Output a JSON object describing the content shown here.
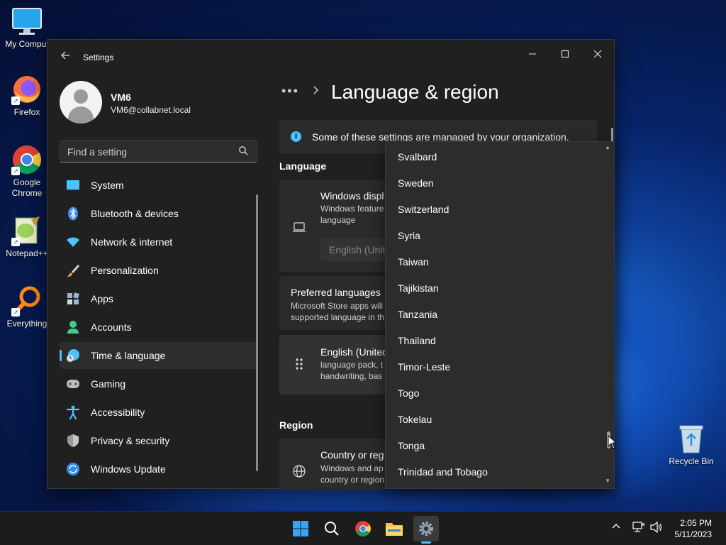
{
  "desktop": {
    "icons": [
      {
        "label": "My Comput",
        "icon": "monitor-icon"
      },
      {
        "label": "Firefox",
        "icon": "firefox-icon"
      },
      {
        "label": "Google Chrome",
        "icon": "chrome-icon"
      },
      {
        "label": "Notepad++",
        "icon": "notepadpp-icon"
      },
      {
        "label": "Everything",
        "icon": "everything-icon"
      }
    ],
    "recycle_bin": "Recycle Bin"
  },
  "window": {
    "title": "Settings",
    "controls": {
      "minimize": "—",
      "maximize": "☐",
      "close": "✕"
    }
  },
  "profile": {
    "name": "VM6",
    "email": "VM6@collabnet.local"
  },
  "search": {
    "placeholder": "Find a setting"
  },
  "sidebar": {
    "items": [
      {
        "label": "System",
        "icon": "system-icon",
        "color": "#4cc2ff"
      },
      {
        "label": "Bluetooth & devices",
        "icon": "bluetooth-icon",
        "color": "#3c8ef0"
      },
      {
        "label": "Network & internet",
        "icon": "wifi-icon",
        "color": "#4cc2ff"
      },
      {
        "label": "Personalization",
        "icon": "brush-icon",
        "color": "#e6a15a"
      },
      {
        "label": "Apps",
        "icon": "apps-icon",
        "color": "#a0b4d0"
      },
      {
        "label": "Accounts",
        "icon": "accounts-icon",
        "color": "#3ecf8e"
      },
      {
        "label": "Time & language",
        "icon": "time-language-icon",
        "color": "#4cc2ff",
        "active": true
      },
      {
        "label": "Gaming",
        "icon": "gaming-icon",
        "color": "#bdbdbd"
      },
      {
        "label": "Accessibility",
        "icon": "accessibility-icon",
        "color": "#4cc2ff"
      },
      {
        "label": "Privacy & security",
        "icon": "shield-icon",
        "color": "#9a9a9a"
      },
      {
        "label": "Windows Update",
        "icon": "update-icon",
        "color": "#2f8fe8"
      }
    ]
  },
  "main": {
    "breadcrumb_dots": "•••",
    "title": "Language & region",
    "info": "Some of these settings are managed by your organization.",
    "language_section": "Language",
    "display_language": {
      "title": "Windows displ",
      "sub1": "Windows feature",
      "sub2": "language",
      "selected": "English (Unit"
    },
    "preferred": {
      "title": "Preferred languages",
      "sub1": "Microsoft Store apps will",
      "sub2": "supported language in th"
    },
    "english_pack": {
      "title": "English (Unitec",
      "sub1": "language pack, t",
      "sub2": "handwriting, bas"
    },
    "region_section": "Region",
    "country": {
      "title": "Country or reg",
      "sub1": "Windows and ap",
      "sub2": "country or region"
    }
  },
  "dropdown": {
    "items": [
      "Svalbard",
      "Sweden",
      "Switzerland",
      "Syria",
      "Taiwan",
      "Tajikistan",
      "Tanzania",
      "Thailand",
      "Timor-Leste",
      "Togo",
      "Tokelau",
      "Tonga",
      "Trinidad and Tobago"
    ]
  },
  "taskbar": {
    "time": "2:05 PM",
    "date": "5/11/2023"
  },
  "colors": {
    "accent": "#4cc2ff",
    "window_bg": "#202020",
    "card_bg": "#2b2b2b"
  }
}
